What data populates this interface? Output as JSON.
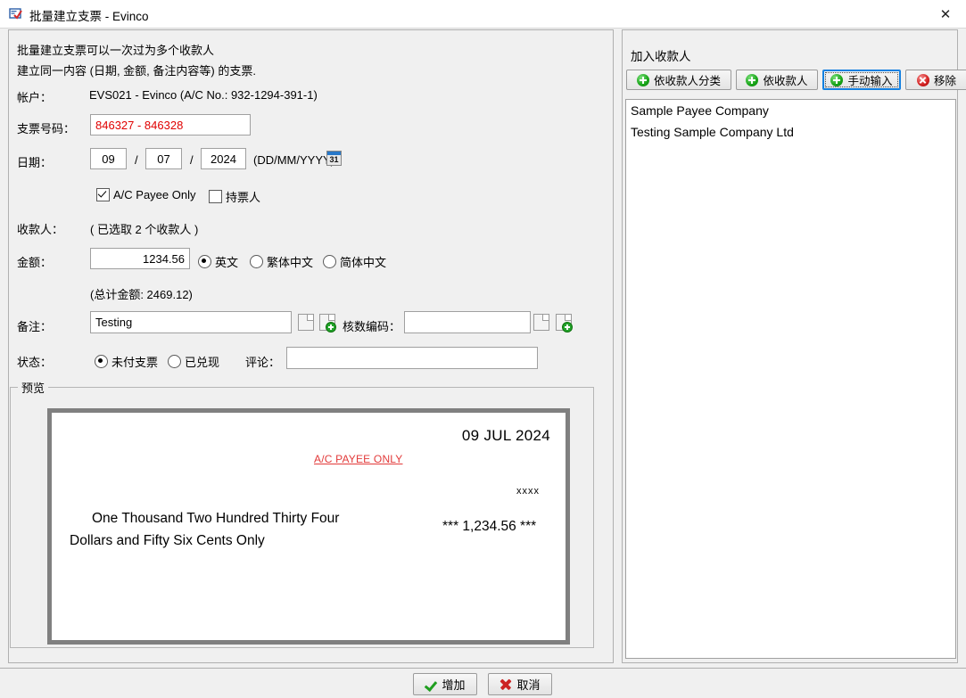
{
  "window": {
    "title": "批量建立支票 - Evinco",
    "app_icon": "cheque-app-icon",
    "close_label": "✕"
  },
  "intro": {
    "line1": "批量建立支票可以一次过为多个收款人",
    "line2": "建立同一内容 (日期, 金额, 备注内容等) 的支票."
  },
  "form": {
    "account_label": "帐户：",
    "account_value": "EVS021 - Evinco (A/C No.: 932-1294-391-1)",
    "cheque_no_label": "支票号码：",
    "cheque_no_value": "846327 - 846328",
    "date_label": "日期：",
    "date_day": "09",
    "date_sep1": "/",
    "date_month": "07",
    "date_sep2": "/",
    "date_year": "2024",
    "date_format_hint": "(DD/MM/YYYY)",
    "calendar_icon_day": "31",
    "ac_payee_only_label": "A/C Payee Only",
    "ac_payee_only_checked": true,
    "bearer_label": "持票人",
    "bearer_checked": false,
    "payee_label": "收款人：",
    "payee_selected_text": "( 已选取  2 个收款人 )",
    "amount_label": "金额：",
    "amount_value": "1234.56",
    "amount_lang_options": [
      "英文",
      "繁体中文",
      "简体中文"
    ],
    "amount_lang_selected": "英文",
    "total_amount_text": "(总计金额: 2469.12)",
    "remark_label": "备注：",
    "remark_value": "Testing",
    "audit_code_label": "核数编码：",
    "audit_code_value": "",
    "status_label": "状态：",
    "status_options": [
      "未付支票",
      "已兑现"
    ],
    "status_selected": "未付支票",
    "comment_label": "评论：",
    "comment_value": ""
  },
  "preview": {
    "legend": "预览",
    "cheque_date": "09 JUL 2024",
    "ac_payee_only": "A/C PAYEE ONLY",
    "payee_mask": "xxxx",
    "words_line1": "One Thousand Two Hundred Thirty Four",
    "words_line2": "Dollars and Fifty Six Cents Only",
    "amount_printed": "*** 1,234.56 ***"
  },
  "payee_panel": {
    "title": "加入收款人",
    "buttons": [
      {
        "label": "依收款人分类",
        "icon": "plus-circle-green-icon",
        "focused": false
      },
      {
        "label": "依收款人",
        "icon": "plus-circle-green-icon",
        "focused": false
      },
      {
        "label": "手动输入",
        "icon": "plus-circle-green-icon",
        "focused": true
      },
      {
        "label": "移除",
        "icon": "cross-circle-red-icon",
        "focused": false
      }
    ],
    "items": [
      "Sample Payee Company",
      "Testing Sample Company Ltd"
    ]
  },
  "footer": {
    "add_label": "增加",
    "cancel_label": "取消"
  },
  "colors": {
    "accent_blue": "#1480e0",
    "cheque_red": "#e23a3a",
    "cheque_no_red": "#e00000",
    "green": "#17a317",
    "window_bg": "#f0f0f0"
  }
}
